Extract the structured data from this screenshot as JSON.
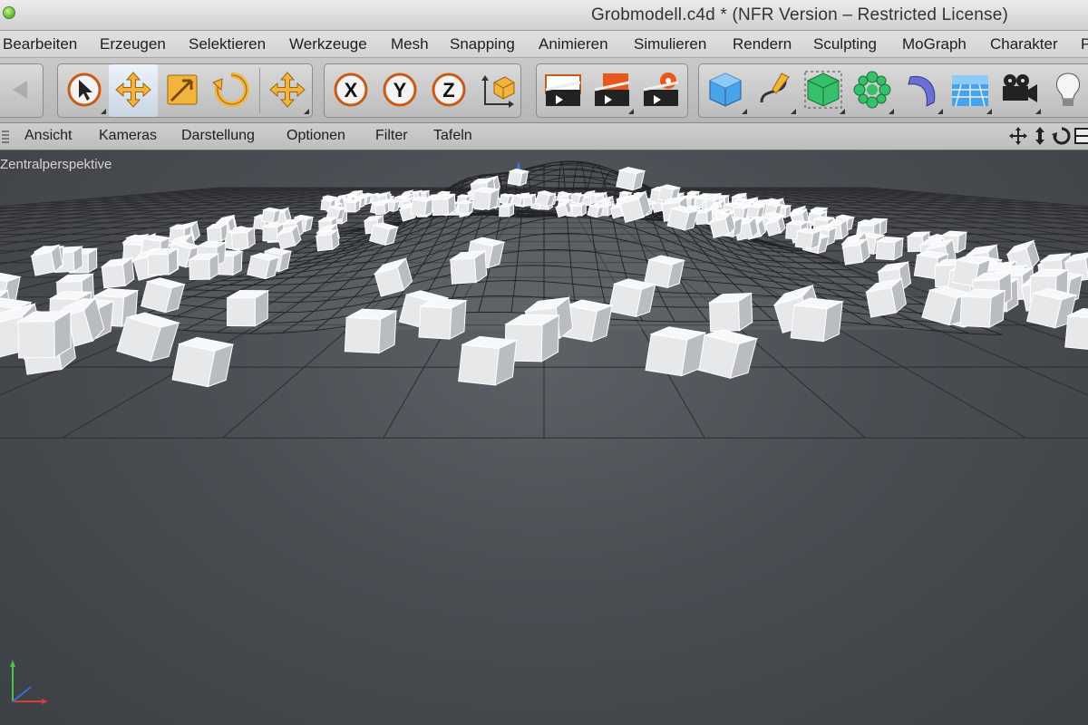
{
  "window": {
    "title": "Grobmodell.c4d * (NFR Version – Restricted License)"
  },
  "menubar": {
    "items": [
      "Bearbeiten",
      "Erzeugen",
      "Selektieren",
      "Werkzeuge",
      "Mesh",
      "Snapping",
      "Animieren",
      "Simulieren",
      "Rendern",
      "Sculpting",
      "MoGraph",
      "Charakter",
      "P"
    ]
  },
  "toolbar": {
    "tools": [
      {
        "name": "undo-icon"
      },
      {
        "name": "live-selection-icon"
      },
      {
        "name": "move-icon",
        "active": true
      },
      {
        "name": "scale-icon"
      },
      {
        "name": "rotate-icon"
      },
      {
        "name": "last-tool-icon"
      },
      {
        "name": "x-axis-lock-icon",
        "label": "X"
      },
      {
        "name": "y-axis-lock-icon",
        "label": "Y"
      },
      {
        "name": "z-axis-lock-icon",
        "label": "Z"
      },
      {
        "name": "coordinate-system-icon"
      },
      {
        "name": "render-view-icon"
      },
      {
        "name": "render-picture-viewer-icon"
      },
      {
        "name": "render-settings-icon"
      },
      {
        "name": "cube-primitive-icon"
      },
      {
        "name": "spline-pen-icon"
      },
      {
        "name": "subdivision-surface-icon"
      },
      {
        "name": "array-icon"
      },
      {
        "name": "deformer-icon"
      },
      {
        "name": "floor-icon"
      },
      {
        "name": "camera-icon"
      },
      {
        "name": "light-icon"
      }
    ]
  },
  "viewport_menu": {
    "items": [
      "Ansicht",
      "Kameras",
      "Darstellung",
      "Optionen",
      "Filter",
      "Tafeln"
    ]
  },
  "viewport": {
    "label": "Zentralperspektive",
    "background_color": "#4a4e53",
    "grid_color": "#2b2d30",
    "clone_color": "#e6e8ea",
    "light_marker_color": "#2f7fe0"
  }
}
